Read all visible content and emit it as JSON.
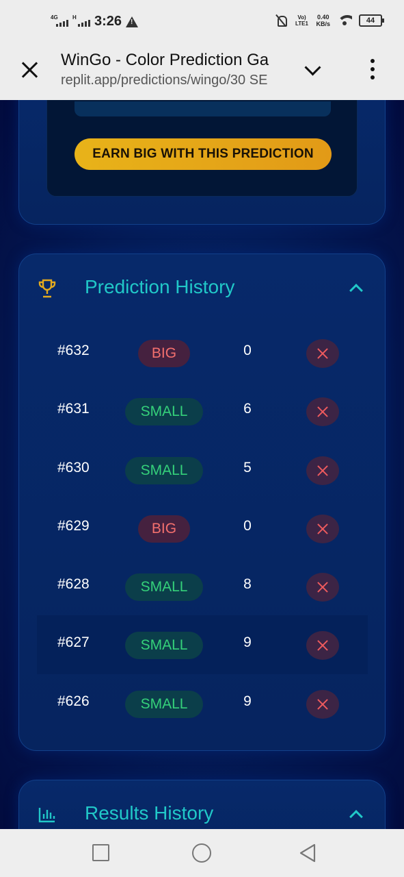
{
  "status_bar": {
    "network_1": "4G",
    "network_2": "H",
    "time": "3:26",
    "volte": "Vo) LTE1",
    "speed_value": "0.40",
    "speed_unit": "KB/s",
    "battery": "44"
  },
  "browser": {
    "title": "WinGo - Color Prediction Ga",
    "url": "replit.app/predictions/wingo/30 SE"
  },
  "prediction": {
    "earn_button": "EARN BIG WITH THIS PREDICTION"
  },
  "prediction_history": {
    "title": "Prediction History",
    "rows": [
      {
        "id": "#632",
        "label": "BIG",
        "number": "0",
        "result": "loss"
      },
      {
        "id": "#631",
        "label": "SMALL",
        "number": "6",
        "result": "loss"
      },
      {
        "id": "#630",
        "label": "SMALL",
        "number": "5",
        "result": "loss"
      },
      {
        "id": "#629",
        "label": "BIG",
        "number": "0",
        "result": "loss"
      },
      {
        "id": "#628",
        "label": "SMALL",
        "number": "8",
        "result": "loss"
      },
      {
        "id": "#627",
        "label": "SMALL",
        "number": "9",
        "result": "loss"
      },
      {
        "id": "#626",
        "label": "SMALL",
        "number": "9",
        "result": "loss"
      }
    ]
  },
  "results_history": {
    "title": "Results History"
  },
  "colors": {
    "accent": "#21c8c8",
    "big": "#f4706e",
    "small": "#35d17a",
    "button": "#e8b319",
    "loss": "#ee5b5e"
  }
}
